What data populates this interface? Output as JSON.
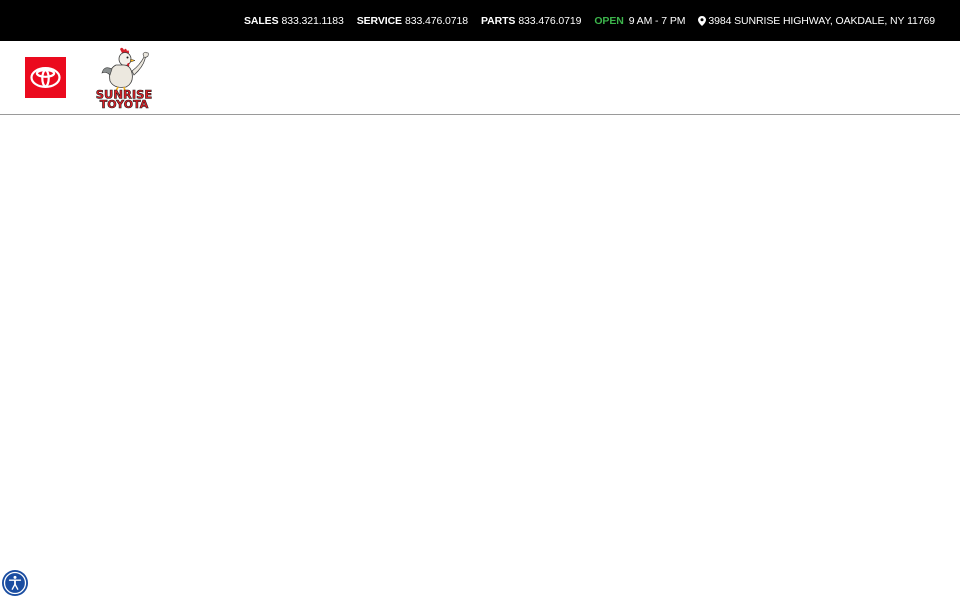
{
  "topbar": {
    "sales_label": "SALES",
    "sales_phone": "833.321.1183",
    "service_label": "SERVICE",
    "service_phone": "833.476.0718",
    "parts_label": "PARTS",
    "parts_phone": "833.476.0719",
    "open_label": "OPEN",
    "hours": "9 AM - 7 PM",
    "address": "3984 SUNRISE HIGHWAY, OAKDALE, NY 11769",
    "address_icon": "map-marker-icon"
  },
  "header": {
    "brand_logo": "toyota-logo",
    "dealer_logo_line1": "SUNRISE",
    "dealer_logo_line2": "TOYOTA"
  },
  "accessibility": {
    "icon": "accessibility-icon"
  },
  "colors": {
    "topbar_bg": "#000000",
    "toyota_red": "#eb0a1e",
    "open_green": "#3cb44b",
    "accessibility_blue": "#1a4da1"
  }
}
